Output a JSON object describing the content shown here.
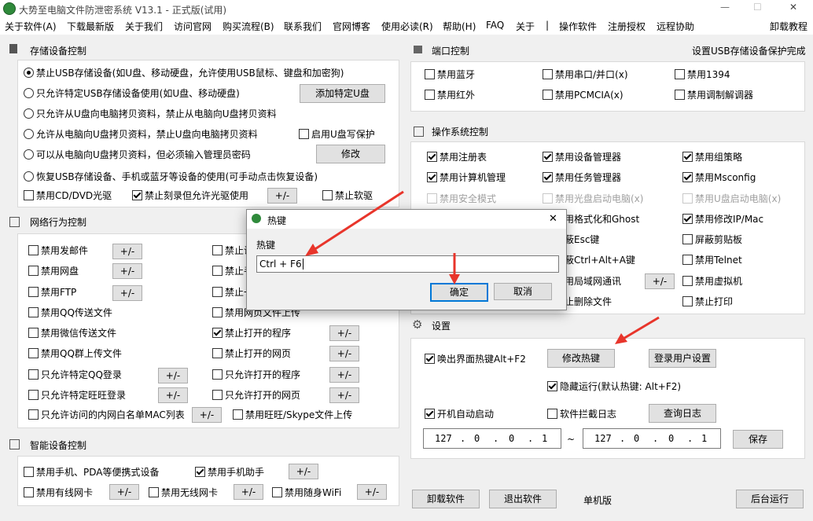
{
  "window": {
    "title": "大势至电脑文件防泄密系统 V13.1 - 正式版(试用)",
    "controls": [
      "—",
      "☐",
      "✕"
    ]
  },
  "menu": {
    "items": [
      "关于软件(A)",
      "下载最新版",
      "关于我们",
      "访问官网",
      "购买流程(B)",
      "联系我们",
      "官网博客",
      "使用必读(R)",
      "帮助(H)",
      "FAQ",
      "关于",
      "|",
      "操作软件",
      "注册授权",
      "远程协助"
    ],
    "uninstall_tutorial": "卸载教程"
  },
  "storage": {
    "title": "存储设备控制",
    "options": [
      "禁止USB存储设备(如U盘、移动硬盘，允许使用USB鼠标、键盘和加密狗)",
      "只允许特定USB存储设备使用(如U盘、移动硬盘)",
      "只允许从U盘向电脑拷贝资料，禁止从电脑向U盘拷贝资料",
      "允许从电脑向U盘拷贝资料，禁止U盘向电脑拷贝资料",
      "可以从电脑向U盘拷贝资料，但必须输入管理员密码",
      "恢复USB存储设备、手机或蓝牙等设备的使用(可手动点击恢复设备)"
    ],
    "add_usb_button": "添加特定U盘",
    "write_protect": "启用U盘写保护",
    "modify_button": "修改",
    "cd_dvd": "禁用CD/DVD光驱",
    "burn": "禁止刻录但允许光驱使用",
    "burn_btn": "+/-",
    "floppy": "禁止软驱"
  },
  "network": {
    "title": "网络行为控制",
    "left": [
      "禁用发邮件",
      "禁用网盘",
      "禁用FTP",
      "禁用QQ传送文件",
      "禁用微信传送文件",
      "禁用QQ群上传文件",
      "只允许特定QQ登录",
      "只允许特定旺旺登录",
      "只允许访问的内网白名单MAC列表"
    ],
    "right": [
      "禁止访",
      "禁止手",
      "禁止一",
      "禁用网页文件上传",
      "禁止打开的程序",
      "禁止打开的网页",
      "只允许打开的程序",
      "只允许打开的网页",
      "禁用旺旺/Skype文件上传"
    ],
    "pm": "+/-"
  },
  "smart": {
    "title": "智能设备控制",
    "items": [
      "禁用手机、PDA等便携式设备",
      "禁用手机助手",
      "禁用有线网卡",
      "禁用无线网卡",
      "禁用随身WiFi"
    ],
    "pm": "+/-"
  },
  "port": {
    "title": "端口控制",
    "status": "设置USB存储设备保护完成",
    "items": [
      "禁用蓝牙",
      "禁用串口/并口(x)",
      "禁用1394",
      "禁用红外",
      "禁用PCMCIA(x)",
      "禁用调制解调器"
    ]
  },
  "os": {
    "title": "操作系统控制",
    "col1": [
      "禁用注册表",
      "禁用计算机管理",
      "禁用安全模式",
      "",
      "",
      "",
      "",
      ""
    ],
    "col2": [
      "禁用设备管理器",
      "禁用任务管理器",
      "禁用光盘启动电脑(x)",
      "用格式化和Ghost",
      "蔽Esc键",
      "蔽Ctrl+Alt+A键",
      "用局域网通讯",
      "止删除文件"
    ],
    "col3": [
      "禁用组策略",
      "禁用Msconfig",
      "禁用U盘启动电脑(x)",
      "禁用修改IP/Mac",
      "屏蔽剪贴板",
      "禁用Telnet",
      "禁用虚拟机",
      "禁止打印"
    ],
    "pm": "+/-"
  },
  "settings": {
    "title": "设置",
    "hotkey_check": "唤出界面热键Alt+F2",
    "modify_hotkey": "修改热键",
    "login_settings": "登录用户设置",
    "hidden_run": "隐藏运行(默认热键: Alt+F2)",
    "autostart": "开机自动启动",
    "intercept_log": "软件拦截日志",
    "query_log": "查询日志",
    "ip_from": [
      "127",
      "0",
      "0",
      "1"
    ],
    "ip_to": [
      "127",
      "0",
      "0",
      "1"
    ],
    "tilde": "~",
    "save": "保存"
  },
  "bottom": {
    "uninstall": "卸载软件",
    "exit": "退出软件",
    "standalone": "单机版",
    "background": "后台运行"
  },
  "dialog": {
    "title": "热键",
    "label": "热键",
    "value": "Ctrl + F6",
    "ok": "确定",
    "cancel": "取消",
    "close": "✕"
  },
  "colors": {
    "arrow": "#e8352b",
    "accent": "#0078d7"
  }
}
